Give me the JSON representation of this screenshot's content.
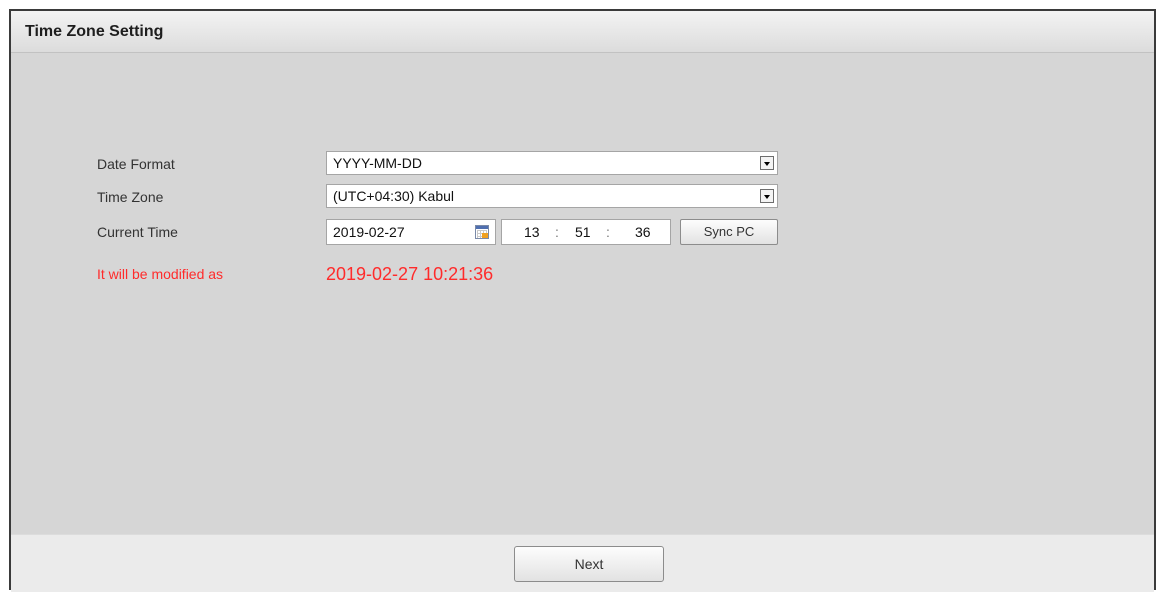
{
  "window": {
    "title": "Time Zone Setting"
  },
  "form": {
    "date_format": {
      "label": "Date Format",
      "value": "YYYY-MM-DD"
    },
    "time_zone": {
      "label": "Time Zone",
      "value": "(UTC+04:30) Kabul"
    },
    "current_time": {
      "label": "Current Time",
      "date": "2019-02-27",
      "hour": "13",
      "minute": "51",
      "second": "36",
      "separator": ":",
      "sync_label": "Sync PC"
    },
    "notice": {
      "label": "It will be modified as",
      "value": "2019-02-27 10:21:36",
      "color": "#ff2b2b"
    }
  },
  "footer": {
    "next_label": "Next"
  }
}
